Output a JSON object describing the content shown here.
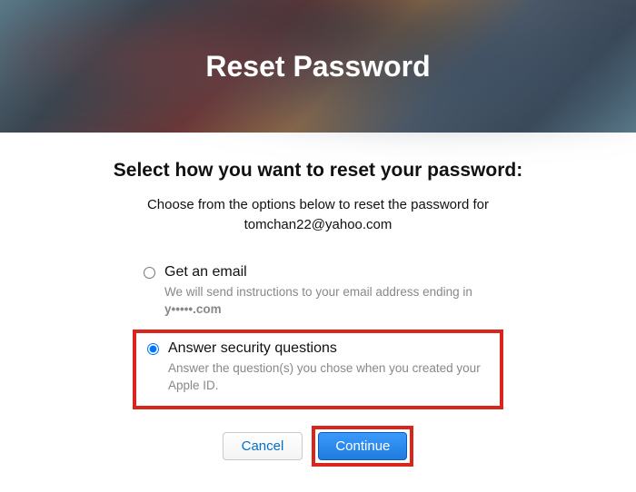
{
  "hero": {
    "title": "Reset Password"
  },
  "subheading": "Select how you want to reset your password:",
  "instruction_prefix": "Choose from the options below to reset the password for",
  "email": "tomchan22@yahoo.com",
  "options": {
    "email": {
      "label": "Get an email",
      "desc_prefix": "We will send instructions to your email address ending in",
      "masked": "y•••••.com"
    },
    "security": {
      "label": "Answer security questions",
      "desc": "Answer the question(s) you chose when you created your Apple ID."
    }
  },
  "buttons": {
    "cancel": "Cancel",
    "continue": "Continue"
  }
}
